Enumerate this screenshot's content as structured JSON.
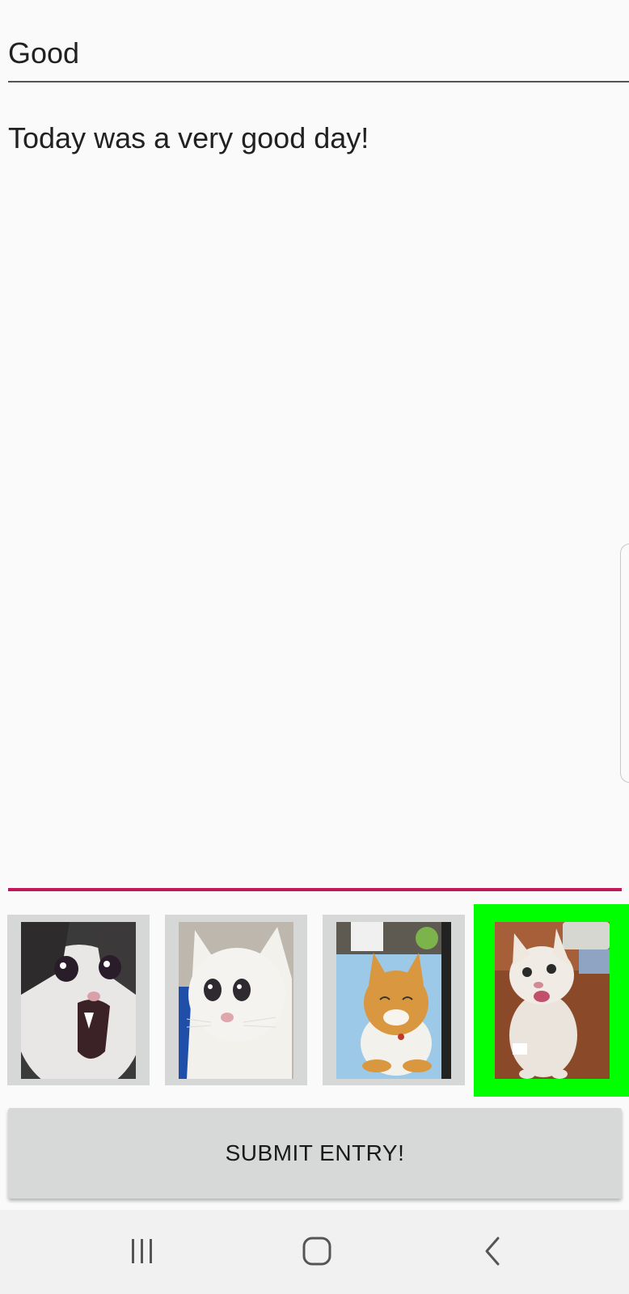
{
  "entry": {
    "title_value": "Good",
    "body_value": "Today was a very good day!"
  },
  "mood_images": [
    {
      "name": "screaming-cat-image",
      "selected": false
    },
    {
      "name": "crying-cat-image",
      "selected": false
    },
    {
      "name": "content-cat-image",
      "selected": false
    },
    {
      "name": "happy-cat-image",
      "selected": true
    }
  ],
  "submit": {
    "label": "SUBMIT ENTRY!"
  },
  "navigation": {
    "items": [
      "recent-apps-icon",
      "home-icon",
      "back-icon"
    ]
  },
  "colors": {
    "accent": "#c2185b",
    "selection": "#00ff00",
    "thumb_bg": "#d6d7d7",
    "button_bg": "#d7d8d8"
  }
}
